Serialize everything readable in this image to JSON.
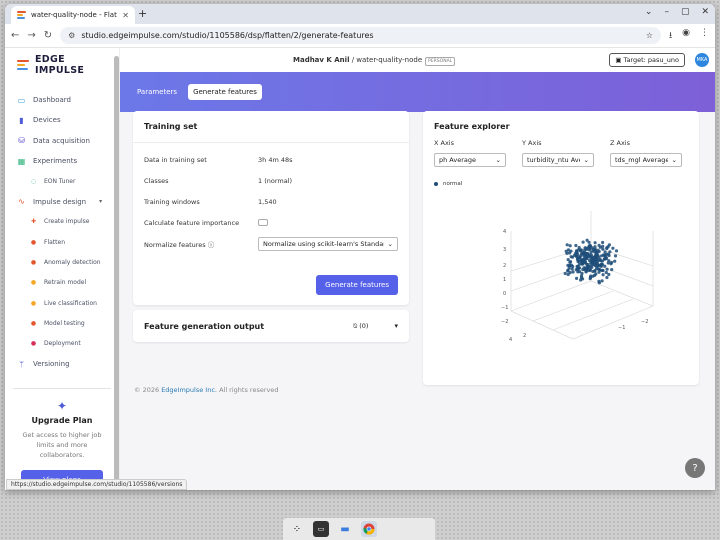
{
  "browser": {
    "tab_title": "water-quality-node - Flatten",
    "url": "studio.edgeimpulse.com/studio/1105586/dsp/flatten/2/generate-features",
    "status_url": "https://studio.edgeimpulse.com/studio/1105586/versions"
  },
  "brand": {
    "name": "EDGE IMPULSE",
    "accent": "#5561e8"
  },
  "sidebar": {
    "items": [
      {
        "label": "Dashboard",
        "icon": "monitor-icon"
      },
      {
        "label": "Devices",
        "icon": "devices-icon"
      },
      {
        "label": "Data acquisition",
        "icon": "database-icon"
      },
      {
        "label": "Experiments",
        "icon": "table-icon"
      },
      {
        "label": "EON Tuner",
        "icon": "tuner-icon"
      },
      {
        "label": "Impulse design",
        "icon": "pulse-icon"
      },
      {
        "label": "Create impulse",
        "icon": "dot-icon"
      },
      {
        "label": "Flatten",
        "icon": "dot-icon"
      },
      {
        "label": "Anomaly detection",
        "icon": "dot-icon"
      },
      {
        "label": "Retrain model",
        "icon": "dot-icon"
      },
      {
        "label": "Live classification",
        "icon": "dot-icon"
      },
      {
        "label": "Model testing",
        "icon": "dot-icon"
      },
      {
        "label": "Deployment",
        "icon": "dot-icon"
      },
      {
        "label": "Versioning",
        "icon": "branch-icon"
      }
    ],
    "upgrade": {
      "title": "Upgrade Plan",
      "text": "Get access to higher job limits and more collaborators.",
      "button": "View plans"
    }
  },
  "header": {
    "user": "Madhav K Anil",
    "project": "water-quality-node",
    "badge": "PERSONAL",
    "target": "Target: pasu_uno",
    "avatar": "MKA"
  },
  "tabs": {
    "parameters": "Parameters",
    "generate": "Generate features"
  },
  "training_set": {
    "title": "Training set",
    "rows": [
      {
        "key": "Data in training set",
        "value": "3h 4m 48s"
      },
      {
        "key": "Classes",
        "value": "1 (normal)"
      },
      {
        "key": "Training windows",
        "value": "1,540"
      }
    ],
    "importance_label": "Calculate feature importance",
    "normalize_label": "Normalize features",
    "normalize_value": "Normalize using scikit-learn's StandardScaler",
    "generate_button": "Generate features"
  },
  "output": {
    "title": "Feature generation output",
    "count": "(0)"
  },
  "explorer": {
    "title": "Feature explorer",
    "x_label": "X Axis",
    "x_value": "ph Average",
    "y_label": "Y Axis",
    "y_value": "turbidity_ntu Average",
    "z_label": "Z Axis",
    "z_value": "tds_mgl Average",
    "legend": "normal",
    "point_color": "#1f4e79"
  },
  "footer": {
    "copy": "© 2026",
    "company": "EdgeImpulse Inc.",
    "rights": "All rights reserved"
  }
}
